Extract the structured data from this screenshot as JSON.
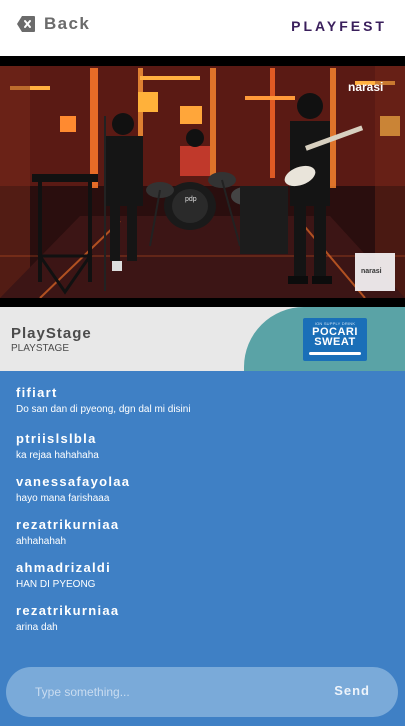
{
  "header": {
    "back_label": "Back",
    "brand": "PLAYFEST"
  },
  "video": {
    "watermark_top": "narasi",
    "watermark_corner": "narasi",
    "drum_logo": "pdp"
  },
  "stage": {
    "title": "PlayStage",
    "subtitle": "PLAYSTAGE",
    "sponsor_small": "ION SUPPLY DRINK",
    "sponsor_name_line1": "POCARI",
    "sponsor_name_line2": "SWEAT"
  },
  "chat": {
    "messages": [
      {
        "user": "fifiart",
        "text": "Do san dan di pyeong, dgn dal mi disini"
      },
      {
        "user": "ptriislslbla",
        "text": "ka rejaa hahahaha"
      },
      {
        "user": "vanessafayolaa",
        "text": "hayo mana farishaaa"
      },
      {
        "user": "rezatrikurniaa",
        "text": "ahhahahah"
      },
      {
        "user": "ahmadrizaldi",
        "text": "HAN DI PYEONG"
      },
      {
        "user": "rezatrikurniaa",
        "text": "arina dah"
      }
    ]
  },
  "composer": {
    "placeholder": "Type something...",
    "send_label": "Send"
  },
  "colors": {
    "chat_bg": "#3f80c5",
    "sponsor_bg": "#5aa3a6",
    "brand": "#3a1f5c"
  }
}
